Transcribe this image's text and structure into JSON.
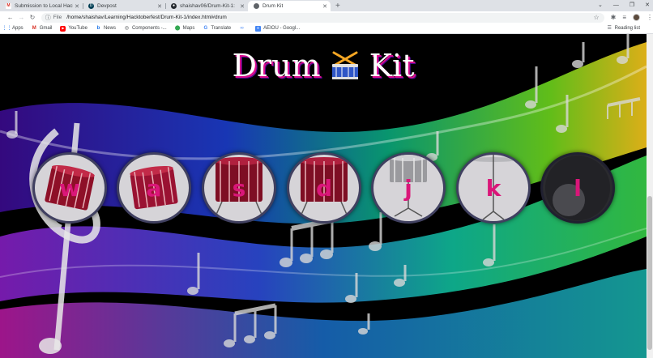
{
  "tabs": [
    {
      "title": "Submission to Local Hack",
      "favicon": "gmail-icon",
      "active": false
    },
    {
      "title": "Devpost",
      "favicon": "devpost-icon",
      "active": false
    },
    {
      "title": "shaishav06/Drum-Kit-1:",
      "favicon": "github-icon",
      "active": false
    },
    {
      "title": "Drum Kit",
      "favicon": "globe-icon",
      "active": true
    }
  ],
  "address": {
    "label": "File",
    "url": "/home/shaishav/Learning/Hacktoberfest/Drum-Kit-1/index.html#drum"
  },
  "bookmarks": [
    {
      "label": "Apps",
      "icon": "apps-grid-icon"
    },
    {
      "label": "Gmail",
      "icon": "gmail-icon"
    },
    {
      "label": "YouTube",
      "icon": "youtube-icon"
    },
    {
      "label": "News",
      "icon": "news-icon"
    },
    {
      "label": "Components -...",
      "icon": "components-icon"
    },
    {
      "label": "Maps",
      "icon": "maps-icon"
    },
    {
      "label": "Translate",
      "icon": "translate-icon"
    },
    {
      "label": "",
      "icon": "link-icon"
    },
    {
      "label": "AEIOU - Googl...",
      "icon": "docs-icon"
    }
  ],
  "reading_list": "Reading list",
  "page": {
    "title_left": "Drum",
    "title_right": "Kit",
    "pads": [
      {
        "key": "w",
        "instrument": "tom"
      },
      {
        "key": "a",
        "instrument": "tom"
      },
      {
        "key": "s",
        "instrument": "tom"
      },
      {
        "key": "d",
        "instrument": "tom"
      },
      {
        "key": "j",
        "instrument": "snare"
      },
      {
        "key": "k",
        "instrument": "crash"
      },
      {
        "key": "l",
        "instrument": "kick"
      }
    ]
  },
  "colors": {
    "accent": "#da1679",
    "drum_red": "#8e1028",
    "title_shadow": "#db0d8e"
  }
}
